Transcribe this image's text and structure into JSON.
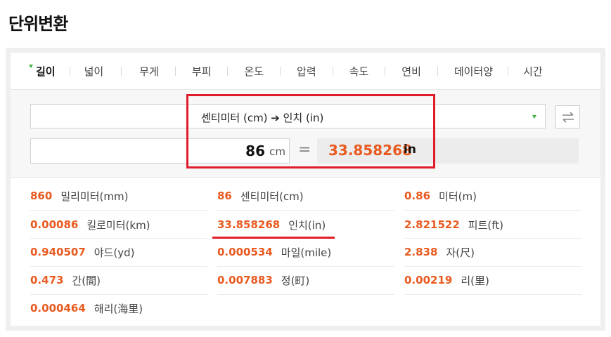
{
  "page": {
    "title": "단위변환"
  },
  "tabs": [
    {
      "label": "길이",
      "active": true
    },
    {
      "label": "넓이",
      "active": false
    },
    {
      "label": "무게",
      "active": false
    },
    {
      "label": "부피",
      "active": false
    },
    {
      "label": "온도",
      "active": false
    },
    {
      "label": "압력",
      "active": false
    },
    {
      "label": "속도",
      "active": false
    },
    {
      "label": "연비",
      "active": false
    },
    {
      "label": "데이터양",
      "active": false
    },
    {
      "label": "시간",
      "active": false
    }
  ],
  "converter": {
    "selected_conversion": "센티미터 (cm)  ➔  인치 (in)",
    "input_value": "86",
    "input_unit": "cm",
    "equals": "=",
    "result_value": "33.858268",
    "result_unit": "in"
  },
  "results": [
    {
      "value": "860",
      "unit": "밀리미터(mm)"
    },
    {
      "value": "86",
      "unit": "센티미터(cm)"
    },
    {
      "value": "0.86",
      "unit": "미터(m)"
    },
    {
      "value": "0.00086",
      "unit": "킬로미터(km)"
    },
    {
      "value": "33.858268",
      "unit": "인치(in)"
    },
    {
      "value": "2.821522",
      "unit": "피트(ft)"
    },
    {
      "value": "0.940507",
      "unit": "야드(yd)"
    },
    {
      "value": "0.000534",
      "unit": "마일(mile)"
    },
    {
      "value": "2.838",
      "unit": "자(尺)"
    },
    {
      "value": "0.473",
      "unit": "간(間)"
    },
    {
      "value": "0.007883",
      "unit": "정(町)"
    },
    {
      "value": "0.00219",
      "unit": "리(里)"
    },
    {
      "value": "0.000464",
      "unit": "해리(海里)"
    }
  ],
  "colors": {
    "accent_orange": "#e85a20",
    "highlight_red": "#e01c2a",
    "caret_green": "#3fb33f"
  }
}
